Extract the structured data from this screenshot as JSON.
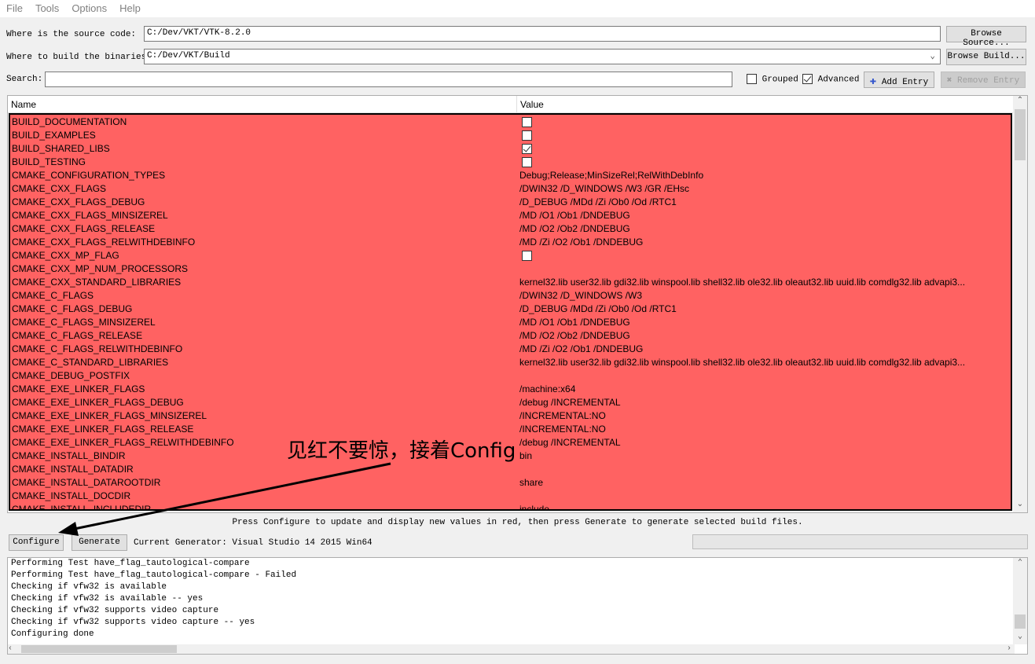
{
  "menu": [
    "File",
    "Tools",
    "Options",
    "Help"
  ],
  "source": {
    "label": "Where is the source code:",
    "value": "C:/Dev/VKT/VTK-8.2.0",
    "browse": "Browse Source..."
  },
  "build": {
    "label": "Where to build the binaries:",
    "value": "C:/Dev/VKT/Build",
    "browse": "Browse Build..."
  },
  "search": {
    "label": "Search:",
    "value": ""
  },
  "options": {
    "grouped": {
      "label": "Grouped",
      "checked": false
    },
    "advanced": {
      "label": "Advanced",
      "checked": true
    },
    "add_entry": "Add Entry",
    "remove_entry": "Remove Entry"
  },
  "table": {
    "columns": [
      "Name",
      "Value"
    ],
    "rows": [
      {
        "name": "BUILD_DOCUMENTATION",
        "type": "bool",
        "checked": false
      },
      {
        "name": "BUILD_EXAMPLES",
        "type": "bool",
        "checked": false
      },
      {
        "name": "BUILD_SHARED_LIBS",
        "type": "bool",
        "checked": true
      },
      {
        "name": "BUILD_TESTING",
        "type": "bool",
        "checked": false
      },
      {
        "name": "CMAKE_CONFIGURATION_TYPES",
        "value": "Debug;Release;MinSizeRel;RelWithDebInfo"
      },
      {
        "name": "CMAKE_CXX_FLAGS",
        "value": " /DWIN32 /D_WINDOWS /W3 /GR /EHsc"
      },
      {
        "name": "CMAKE_CXX_FLAGS_DEBUG",
        "value": "/D_DEBUG /MDd /Zi /Ob0 /Od /RTC1"
      },
      {
        "name": "CMAKE_CXX_FLAGS_MINSIZEREL",
        "value": "/MD /O1 /Ob1 /DNDEBUG"
      },
      {
        "name": "CMAKE_CXX_FLAGS_RELEASE",
        "value": "/MD /O2 /Ob2 /DNDEBUG"
      },
      {
        "name": "CMAKE_CXX_FLAGS_RELWITHDEBINFO",
        "value": "/MD /Zi /O2 /Ob1 /DNDEBUG"
      },
      {
        "name": "CMAKE_CXX_MP_FLAG",
        "type": "bool",
        "checked": false
      },
      {
        "name": "CMAKE_CXX_MP_NUM_PROCESSORS",
        "value": ""
      },
      {
        "name": "CMAKE_CXX_STANDARD_LIBRARIES",
        "value": "kernel32.lib user32.lib gdi32.lib winspool.lib shell32.lib ole32.lib oleaut32.lib uuid.lib comdlg32.lib advapi3..."
      },
      {
        "name": "CMAKE_C_FLAGS",
        "value": " /DWIN32 /D_WINDOWS /W3"
      },
      {
        "name": "CMAKE_C_FLAGS_DEBUG",
        "value": "/D_DEBUG /MDd /Zi /Ob0 /Od /RTC1"
      },
      {
        "name": "CMAKE_C_FLAGS_MINSIZEREL",
        "value": "/MD /O1 /Ob1 /DNDEBUG"
      },
      {
        "name": "CMAKE_C_FLAGS_RELEASE",
        "value": "/MD /O2 /Ob2 /DNDEBUG"
      },
      {
        "name": "CMAKE_C_FLAGS_RELWITHDEBINFO",
        "value": "/MD /Zi /O2 /Ob1 /DNDEBUG"
      },
      {
        "name": "CMAKE_C_STANDARD_LIBRARIES",
        "value": "kernel32.lib user32.lib gdi32.lib winspool.lib shell32.lib ole32.lib oleaut32.lib uuid.lib comdlg32.lib advapi3..."
      },
      {
        "name": "CMAKE_DEBUG_POSTFIX",
        "value": ""
      },
      {
        "name": "CMAKE_EXE_LINKER_FLAGS",
        "value": " /machine:x64"
      },
      {
        "name": "CMAKE_EXE_LINKER_FLAGS_DEBUG",
        "value": "/debug /INCREMENTAL"
      },
      {
        "name": "CMAKE_EXE_LINKER_FLAGS_MINSIZEREL",
        "value": "/INCREMENTAL:NO"
      },
      {
        "name": "CMAKE_EXE_LINKER_FLAGS_RELEASE",
        "value": "/INCREMENTAL:NO"
      },
      {
        "name": "CMAKE_EXE_LINKER_FLAGS_RELWITHDEBINFO",
        "value": "/debug /INCREMENTAL"
      },
      {
        "name": "CMAKE_INSTALL_BINDIR",
        "value": "bin"
      },
      {
        "name": "CMAKE_INSTALL_DATADIR",
        "value": ""
      },
      {
        "name": "CMAKE_INSTALL_DATAROOTDIR",
        "value": "share"
      },
      {
        "name": "CMAKE_INSTALL_DOCDIR",
        "value": ""
      },
      {
        "name": "CMAKE_INSTALL_INCLUDEDIR",
        "value": "include"
      }
    ]
  },
  "colors": {
    "new_entry": "#ff6262"
  },
  "hint": "Press Configure to update and display new values in red, then press Generate to generate selected build files.",
  "configure": "Configure",
  "generate": "Generate",
  "generator": "Current Generator: Visual Studio 14 2015 Win64",
  "progress": 0,
  "log": [
    "Performing Test have_flag_tautological-compare",
    "Performing Test have_flag_tautological-compare - Failed",
    "Checking if vfw32 is available",
    "Checking if vfw32 is available -- yes",
    "Checking if vfw32 supports video capture",
    "Checking if vfw32 supports video capture -- yes",
    "Configuring done"
  ],
  "annotation": "见红不要惊，接着Config"
}
